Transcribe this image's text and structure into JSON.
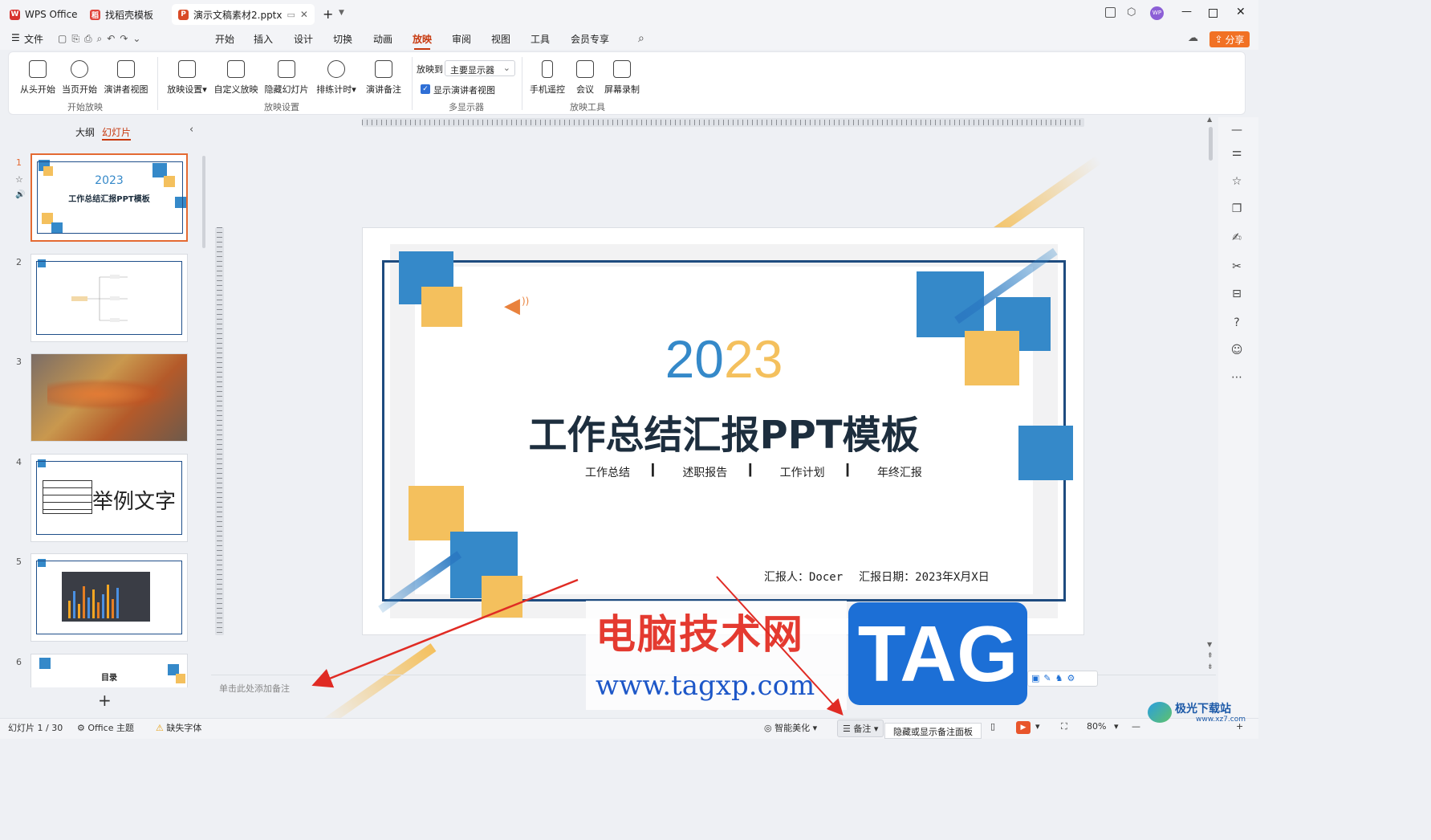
{
  "tabs": [
    {
      "label": "WPS Office"
    },
    {
      "label": "找稻壳模板"
    },
    {
      "label": "演示文稿素材2.pptx"
    }
  ],
  "menu": {
    "file": "文件",
    "items": [
      "开始",
      "插入",
      "设计",
      "切换",
      "动画",
      "放映",
      "审阅",
      "视图",
      "工具",
      "会员专享"
    ],
    "share": "分享"
  },
  "ribbon": {
    "start_group": {
      "label": "开始放映",
      "buttons": [
        "从头开始",
        "当页开始",
        "演讲者视图"
      ]
    },
    "setting_group": {
      "label": "放映设置",
      "buttons": [
        "放映设置",
        "自定义放映",
        "隐藏幻灯片",
        "排练计时",
        "演讲备注"
      ]
    },
    "monitor_group": {
      "label": "多显示器",
      "show_on": "放映到",
      "display": "主要显示器",
      "checkbox": "显示演讲者视图",
      "checked": true
    },
    "tools_group": {
      "label": "放映工具",
      "buttons": [
        "手机遥控",
        "会议",
        "屏幕录制"
      ]
    }
  },
  "pane": {
    "outline": "大纲",
    "slides": "幻灯片"
  },
  "thumbs": {
    "s1_year": "2023",
    "s1_title": "工作总结汇报PPT模板",
    "s4_text": "举例文字",
    "s6_title": "目录"
  },
  "slide": {
    "year_a": "20",
    "year_b": "23",
    "title": "工作总结汇报PPT模板",
    "subtitles": [
      "工作总结",
      "述职报告",
      "工作计划",
      "年终汇报"
    ],
    "reporter": "汇报人：Docer",
    "date": "汇报日期：2023年X月X日"
  },
  "notes_placeholder": "单击此处添加备注",
  "status": {
    "slide_count": "幻灯片 1 / 30",
    "theme": "Office 主题",
    "missing_font": "缺失字体",
    "beautify": "智能美化",
    "notes": "备注",
    "tooltip": "隐藏或显示备注面板",
    "zoom": "80%"
  },
  "watermark": {
    "site_cn": "电脑技术网",
    "url": "www.tagxp.com",
    "tag": "TAG",
    "logo": "极光下载站",
    "logo_url": "www.xz7.com"
  }
}
